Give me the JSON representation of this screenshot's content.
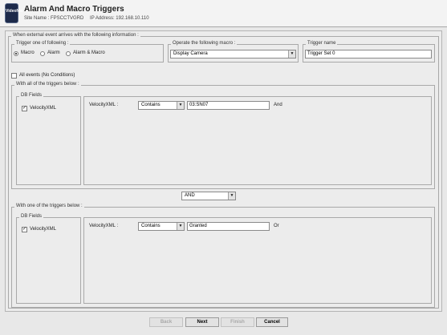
{
  "header": {
    "logo_text": "VideoNet",
    "title": "Alarm And Macro Triggers",
    "site_label": "Site Name : FPSCCTVGRD",
    "ip_label": "IP Address: 192.168.10.110"
  },
  "main_group_label": "When external event arrives with the following information :",
  "trigger": {
    "group_label": "Trigger one of following :",
    "options": [
      "Macro",
      "Alarm",
      "Alarm & Macro"
    ],
    "selected": "Macro"
  },
  "macro": {
    "group_label": "Operate the following macro :",
    "value": "Display Camera"
  },
  "trigger_name": {
    "group_label": "Trigger name",
    "value": "Trigger Set 0"
  },
  "all_events_label": "All events (No Conditions)",
  "all_group": {
    "label": "With all of the triggers below :",
    "db_fields_label": "DB Fields",
    "field_label": "VelocityXML",
    "condition_label": "VelocityXML :",
    "operator": "Contains",
    "value": "03:SN07",
    "suffix": "And"
  },
  "combinator": "AND",
  "one_group": {
    "label": "With one of the triggers below :",
    "db_fields_label": "DB Fields",
    "field_label": "VelocityXML",
    "condition_label": "VelocityXML :",
    "operator": "Contains",
    "value": "Granted",
    "suffix": "Or"
  },
  "buttons": {
    "back": "Back",
    "next": "Next",
    "finish": "Finish",
    "cancel": "Cancel"
  }
}
